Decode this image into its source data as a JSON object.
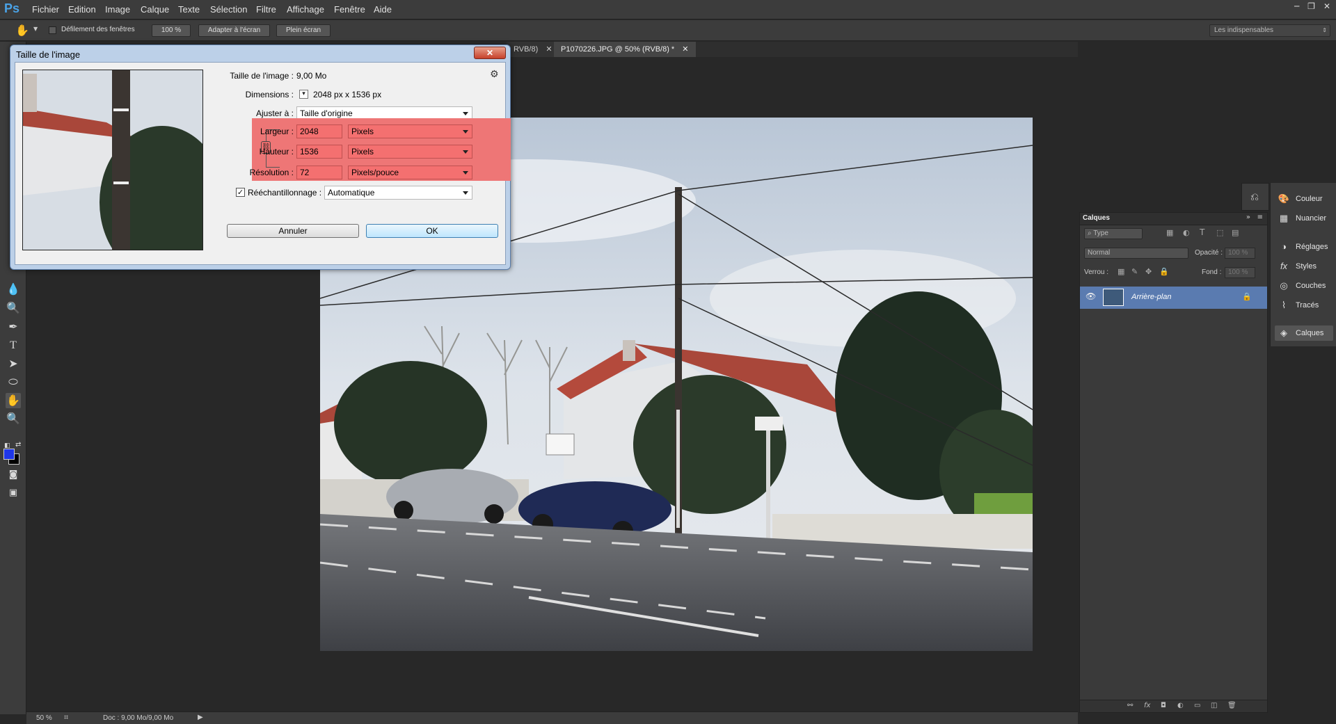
{
  "app": {
    "logo": "Ps"
  },
  "menu": [
    "Fichier",
    "Edition",
    "Image",
    "Calque",
    "Texte",
    "Sélection",
    "Filtre",
    "Affichage",
    "Fenêtre",
    "Aide"
  ],
  "window_controls": {
    "minimize": "─",
    "restore": "❐",
    "close": "✕"
  },
  "options_bar": {
    "scroll_all_windows": "Défilement des fenêtres",
    "zoom_100": "100 %",
    "fit_screen": "Adapter à l'écran",
    "full_screen": "Plein écran",
    "workspace": "Les indispensables"
  },
  "tabs": [
    {
      "label": "RVB/8)",
      "close": "✕"
    },
    {
      "label": "P1070226.JPG @ 50% (RVB/8) *",
      "close": "✕"
    }
  ],
  "status": {
    "zoom": "50 %",
    "doc": "Doc : 9,00 Mo/9,00 Mo"
  },
  "layers_panel": {
    "title": "Calques",
    "filter_type": "Type",
    "blend_mode": "Normal",
    "opacity_label": "Opacité :",
    "opacity_value": "100 %",
    "lock_label": "Verrou :",
    "fill_label": "Fond :",
    "fill_value": "100 %",
    "layer_name": "Arrière-plan",
    "footer_fx": "fx"
  },
  "dock": [
    "Couleur",
    "Nuancier",
    "Réglages",
    "Styles",
    "Couches",
    "Tracés",
    "Calques"
  ],
  "dialog": {
    "title": "Taille de l'image",
    "close": "✕",
    "image_size_label": "Taille de l'image :",
    "image_size_value": "9,00 Mo",
    "dimensions_label": "Dimensions :",
    "dimensions_value": "2048 px x 1536 px",
    "fit_to_label": "Ajuster à :",
    "fit_to_value": "Taille d'origine",
    "width_label": "Largeur :",
    "width_value": "2048",
    "width_unit": "Pixels",
    "height_label": "Hauteur :",
    "height_value": "1536",
    "height_unit": "Pixels",
    "resolution_label": "Résolution :",
    "resolution_value": "72",
    "resolution_unit": "Pixels/pouce",
    "resample_label": "Rééchantillonnage :",
    "resample_value": "Automatique",
    "cancel": "Annuler",
    "ok": "OK"
  }
}
